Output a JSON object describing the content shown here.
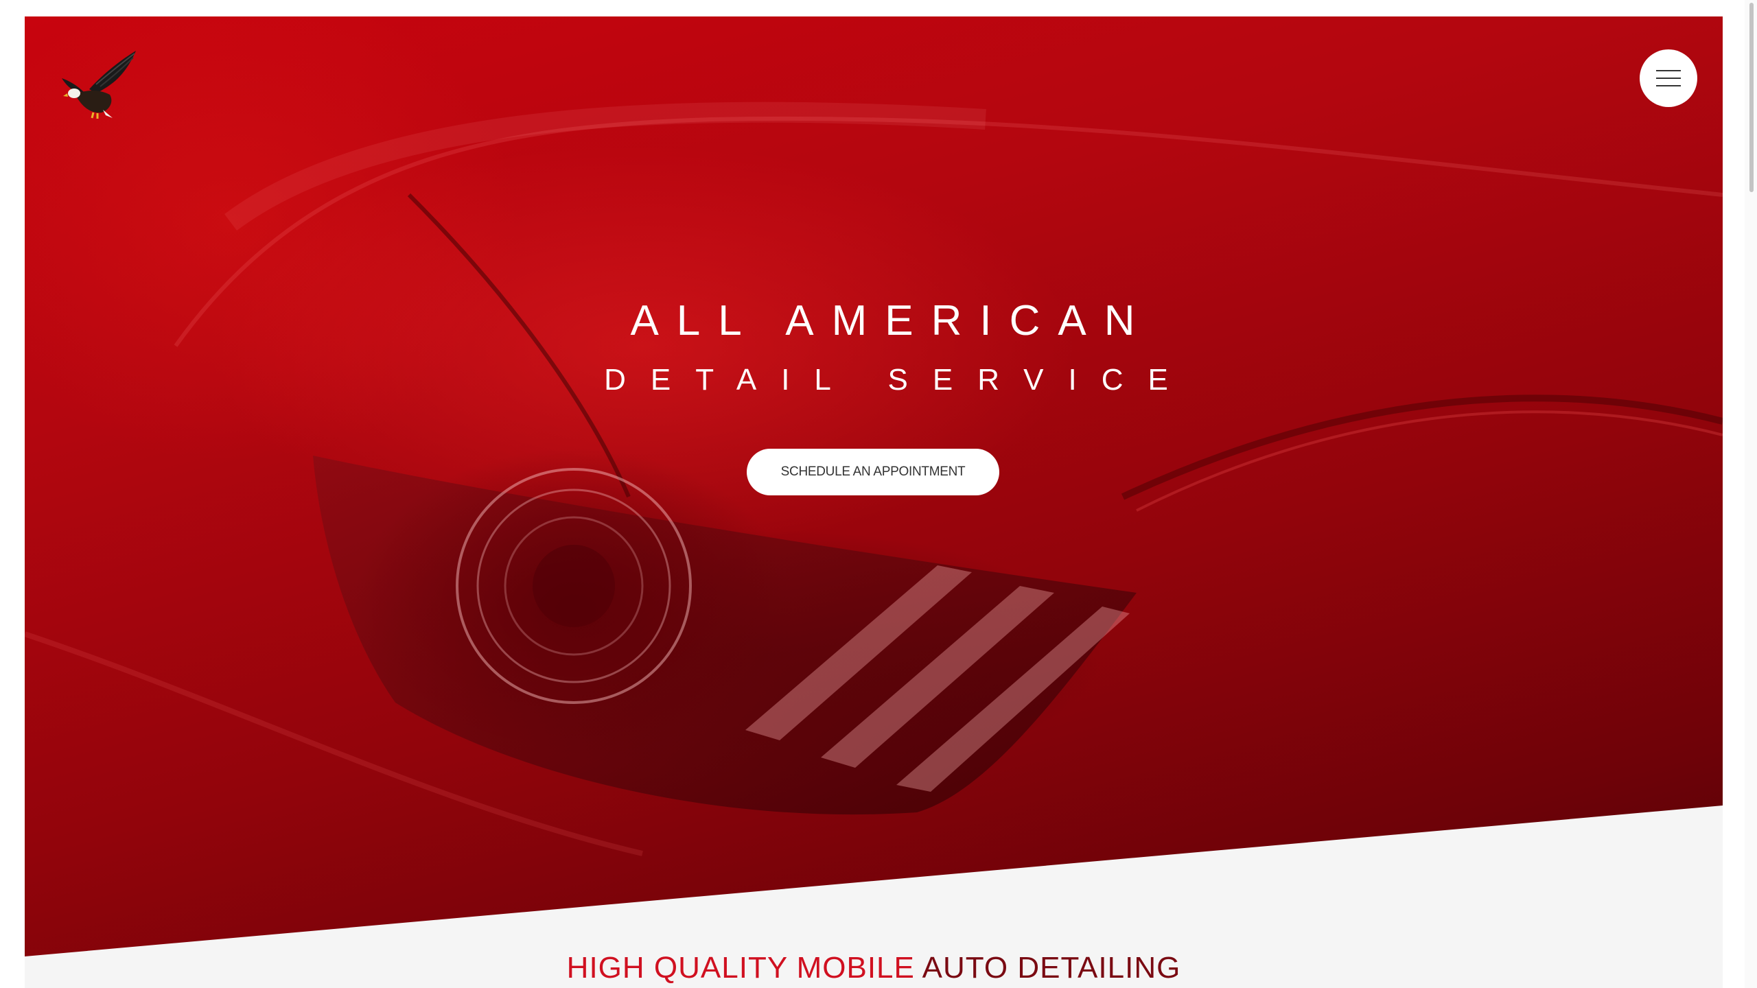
{
  "hero": {
    "title_line1": "ALL AMERICAN",
    "title_line2": "DETAIL SERVICE",
    "cta_label": "SCHEDULE AN APPOINTMENT"
  },
  "header": {
    "logo_icon": "eagle-logo-icon",
    "menu_icon": "hamburger-menu-icon"
  },
  "section": {
    "title_part1": "HIGH QUALITY MOBILE",
    "title_part2": "AUTO DETAILING"
  },
  "colors": {
    "brand_red": "#c8040e",
    "dark_red": "#6e0208",
    "title_red_start": "#d01020",
    "title_red_end": "#7a0a12",
    "white": "#ffffff",
    "page_bg": "#f5f5f5"
  }
}
